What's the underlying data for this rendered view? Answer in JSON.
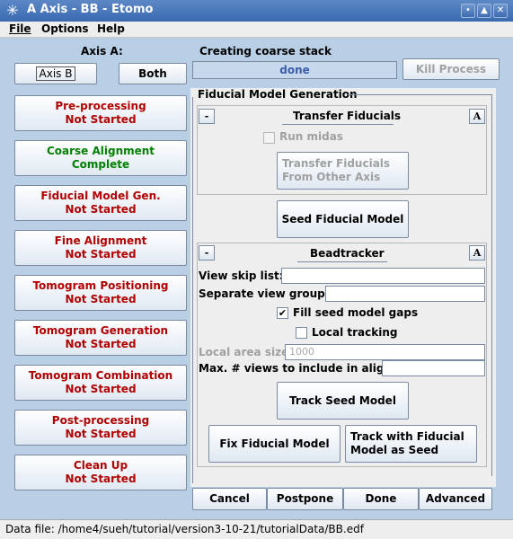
{
  "window": {
    "title": "A Axis - BB - Etomo",
    "logo_glyph": "✳",
    "min_glyph": "•",
    "max_glyph": "▲",
    "close_glyph": "✕"
  },
  "menu": {
    "file": "File",
    "options": "Options",
    "help": "Help"
  },
  "axis_label": "Axis A:",
  "process": {
    "label": "Creating coarse stack",
    "progress_text": "done",
    "progress_fraction": 1.0,
    "kill_label": "Kill Process"
  },
  "axis_buttons": {
    "axis_b": "Axis B",
    "both": "Both"
  },
  "stages": [
    {
      "name": "Pre-processing",
      "status": "Not Started",
      "color": "#b00000"
    },
    {
      "name": "Coarse Alignment",
      "status": "Complete",
      "color": "#008000"
    },
    {
      "name": "Fiducial Model Gen.",
      "status": "Not Started",
      "color": "#b00000"
    },
    {
      "name": "Fine Alignment",
      "status": "Not Started",
      "color": "#b00000"
    },
    {
      "name": "Tomogram Positioning",
      "status": "Not Started",
      "color": "#b00000"
    },
    {
      "name": "Tomogram Generation",
      "status": "Not Started",
      "color": "#b00000"
    },
    {
      "name": "Tomogram Combination",
      "status": "Not Started",
      "color": "#b00000"
    },
    {
      "name": "Post-processing",
      "status": "Not Started",
      "color": "#b00000"
    },
    {
      "name": "Clean Up",
      "status": "Not Started",
      "color": "#b00000"
    }
  ],
  "fiducial": {
    "section_title": "Fiducial Model Generation",
    "transfer": {
      "collapse": "-",
      "title": "Transfer Fiducials",
      "advanced": "A",
      "run_midas": "Run midas",
      "transfer_btn_line1": "Transfer Fiducials",
      "transfer_btn_line2": "From Other Axis"
    },
    "seed_btn": "Seed Fiducial Model",
    "beadtracker": {
      "collapse": "-",
      "title": "Beadtracker",
      "advanced": "A",
      "view_skip_label": "View skip list:",
      "view_skip_value": "",
      "separate_groups_label": "Separate view groups:",
      "separate_groups_value": "",
      "fill_gaps_label": "Fill seed model gaps",
      "fill_gaps_checked": true,
      "local_tracking_label": "Local tracking",
      "local_tracking_checked": false,
      "local_area_label": "Local area size:",
      "local_area_value": "1000",
      "max_views_label": "Max. # views to include in align:",
      "max_views_value": "",
      "track_btn": "Track Seed Model",
      "fix_btn": "Fix Fiducial Model",
      "track_fid_line1": "Track with Fiducial",
      "track_fid_line2": "Model as Seed"
    }
  },
  "bottom_buttons": {
    "cancel": "Cancel",
    "postpone": "Postpone",
    "done": "Done",
    "advanced": "Advanced"
  },
  "status": {
    "data_file": "Data file: /home4/sueh/tutorial/version3-10-21/tutorialData/BB.edf"
  }
}
